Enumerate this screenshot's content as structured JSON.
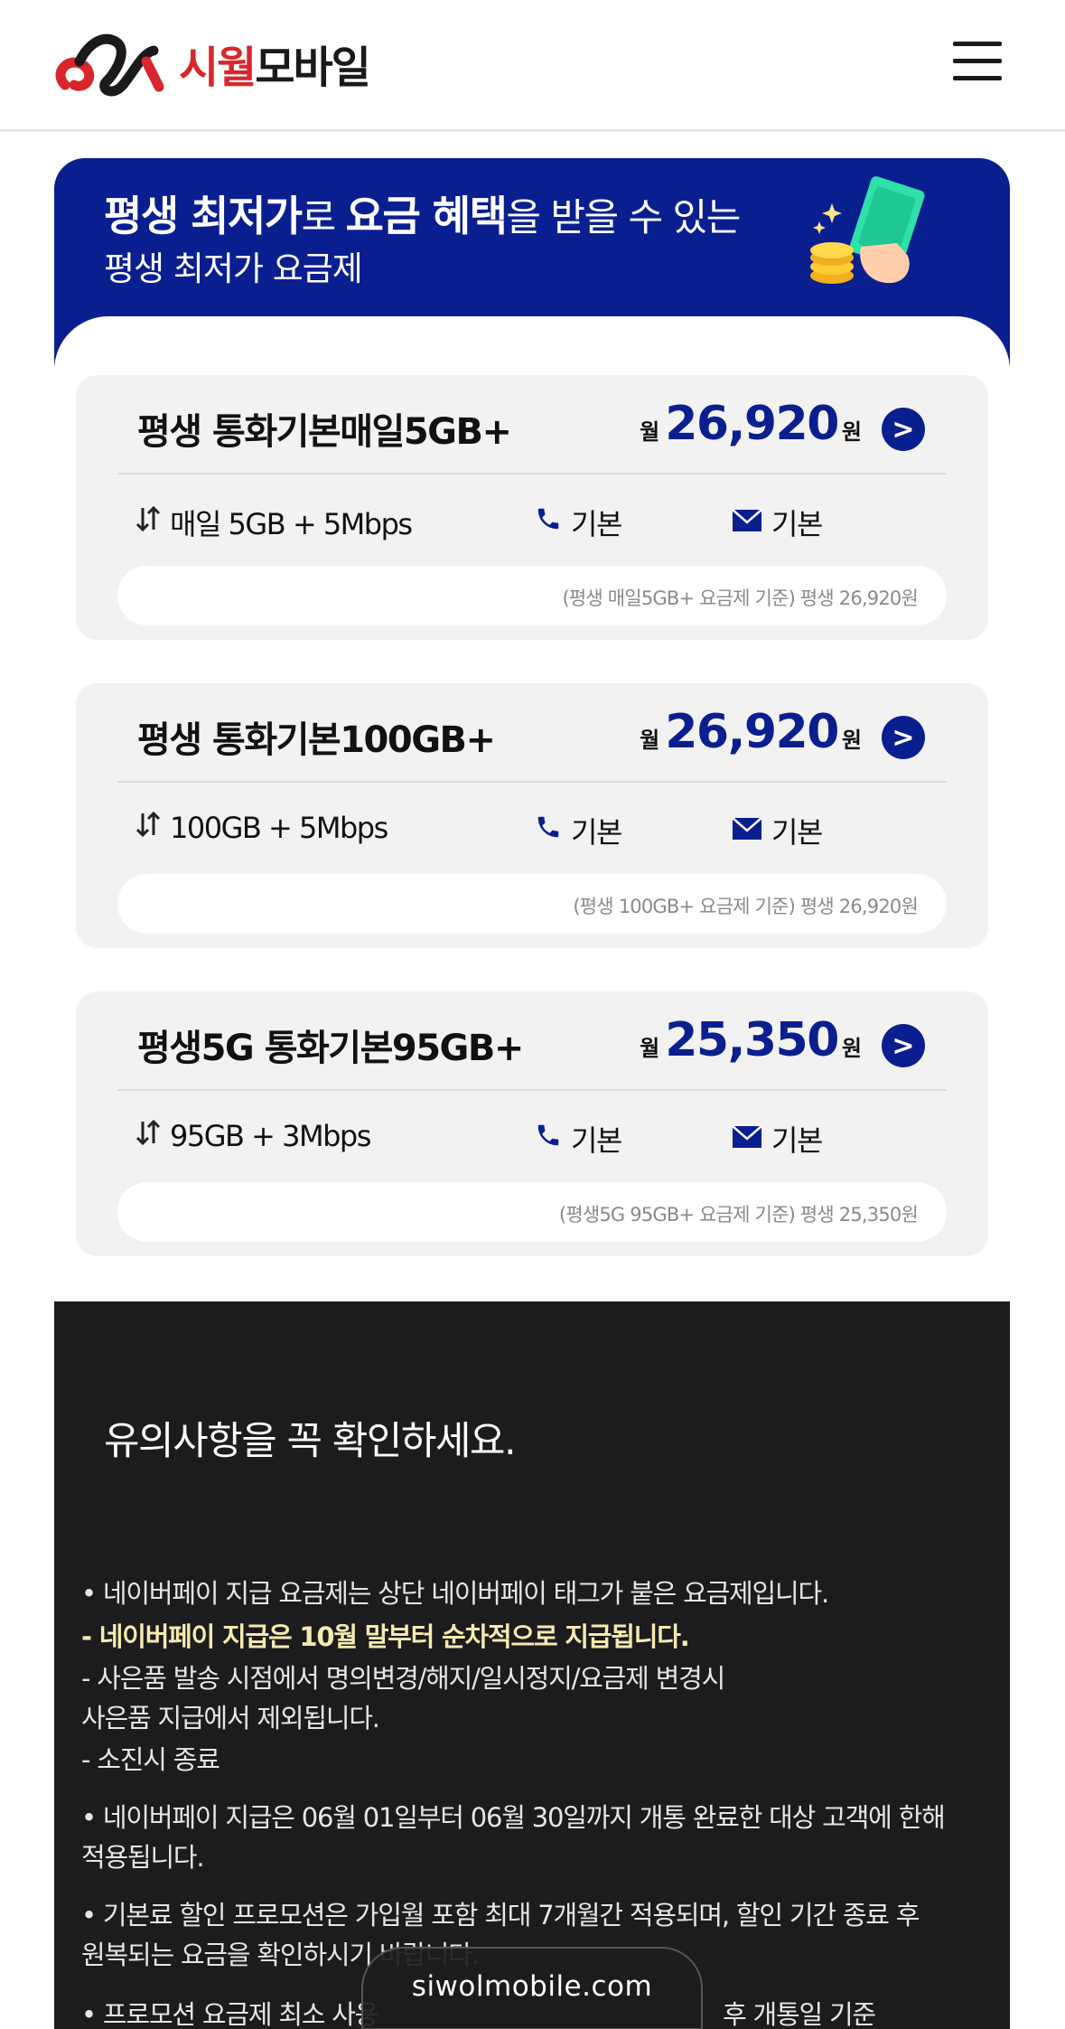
{
  "header": {
    "logo_text_red": "시월",
    "logo_text_black": "모바일",
    "logo_icon": "siwol-logo-mark",
    "menu_icon": "hamburger-icon"
  },
  "banner": {
    "line1_b1": "평생 최저가",
    "line1_t1": "로 ",
    "line1_b2": "요금 혜택",
    "line1_t2": "을 받을 수 있는",
    "line2": "평생 최저가 요금제",
    "illustration_icon": "money-hand-illustration"
  },
  "plans": [
    {
      "name": "평생 통화기본매일5GB+",
      "price_prefix": "월",
      "price": "26,920",
      "price_suffix": "원",
      "data": "매일 5GB + 5Mbps",
      "call": "기본",
      "sms": "기본",
      "note": "(평생 매일5GB+ 요금제 기준) 평생 26,920원"
    },
    {
      "name": "평생 통화기본100GB+",
      "price_prefix": "월",
      "price": "26,920",
      "price_suffix": "원",
      "data": "100GB + 5Mbps",
      "call": "기본",
      "sms": "기본",
      "note": "(평생 100GB+ 요금제 기준) 평생 26,920원"
    },
    {
      "name": "평생5G 통화기본95GB+",
      "price_prefix": "월",
      "price": "25,350",
      "price_suffix": "원",
      "data": "95GB + 3Mbps",
      "call": "기본",
      "sms": "기본",
      "note": "(평생5G 95GB+ 요금제 기준) 평생 25,350원"
    }
  ],
  "notice": {
    "title": "유의사항을 꼭 확인하세요.",
    "lines": [
      "• 네이버페이 지급 요금제는 상단 네이버페이 태그가 붙은 요금제입니다.",
      "- 네이버페이 지급은 10월 말부터 순차적으로 지급됩니다.",
      "- 사은품 발송 시점에서 명의변경/해지/일시정지/요금제 변경시",
      "  사은품 지급에서 제외됩니다.",
      "- 소진시 종료",
      "• 네이버페이 지급은 06월 01일부터 06월 30일까지 개통 완료한 대상 고객에 한해",
      "  적용됩니다.",
      "• 기본료 할인 프로모션은 가입월 포함 최대 7개월간 적용되며, 할인 기간 종료 후",
      "  원복되는 요금을 확인하시기 바랍니다.",
      "• 프로모션 요금제 최소 사용",
      "후 개통일 기준"
    ]
  },
  "url_pill": "siwolmobile.com"
}
